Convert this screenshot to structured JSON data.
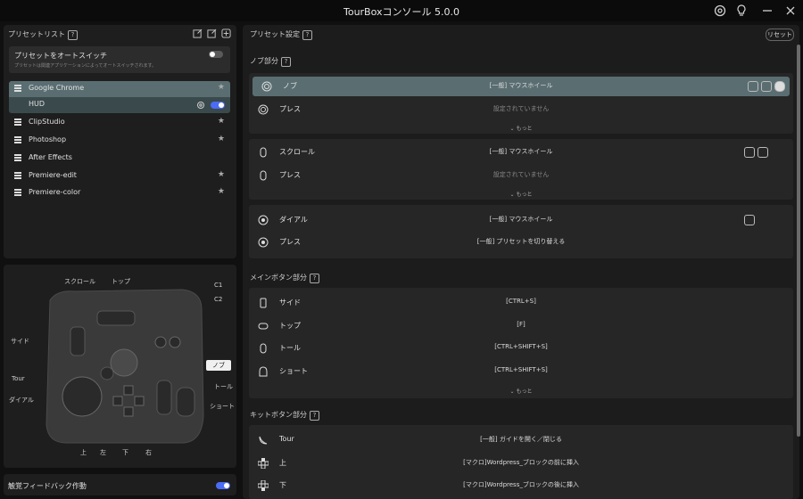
{
  "window": {
    "title": "TourBoxコンソール 5.0.0"
  },
  "preset_list": {
    "title": "プリセットリスト",
    "auto_switch": {
      "label": "プリセットをオートスイッチ",
      "description": "プリセットは関連アプリケーションによってオートスイッチされます。"
    },
    "items": [
      {
        "label": "Google Chrome"
      },
      {
        "label": "HUD"
      },
      {
        "label": "ClipStudio"
      },
      {
        "label": "Photoshop"
      },
      {
        "label": "After Effects"
      },
      {
        "label": "Premiere-edit"
      },
      {
        "label": "Premiere-color"
      }
    ]
  },
  "device": {
    "labels": {
      "scroll": "スクロール",
      "top": "トップ",
      "c1": "C1",
      "c2": "C2",
      "side": "サイド",
      "knob": "ノブ",
      "tour": "Tour",
      "tall": "トール",
      "dial": "ダイアル",
      "short": "ショート",
      "up": "上",
      "left": "左",
      "down": "下",
      "right": "右"
    }
  },
  "haptic": {
    "label": "触覚フィードバック作動",
    "enabled": true
  },
  "settings": {
    "title": "プリセット設定",
    "reset_label": "リセット",
    "knob_section": {
      "title": "ノブ部分",
      "blocks": [
        {
          "rows": [
            {
              "name": "ノブ",
              "value": "[一般] マウスホイール"
            },
            {
              "name": "プレス",
              "value": "設定されていません"
            }
          ],
          "more": "もっと"
        },
        {
          "rows": [
            {
              "name": "スクロール",
              "value": "[一般] マウスホイール"
            },
            {
              "name": "プレス",
              "value": "設定されていません"
            }
          ],
          "more": "もっと"
        },
        {
          "rows": [
            {
              "name": "ダイアル",
              "value": "[一般] マウスホイール"
            },
            {
              "name": "プレス",
              "value": "[一般] プリセットを切り替える"
            }
          ]
        }
      ]
    },
    "main_section": {
      "title": "メインボタン部分",
      "rows": [
        {
          "name": "サイド",
          "value": "[CTRL+S]"
        },
        {
          "name": "トップ",
          "value": "[F]"
        },
        {
          "name": "トール",
          "value": "[CTRL+SHIFT+S]"
        },
        {
          "name": "ショート",
          "value": "[CTRL+SHIFT+S]"
        }
      ],
      "more": "もっと"
    },
    "kit_section": {
      "title": "キットボタン部分",
      "rows": [
        {
          "name": "Tour",
          "value": "[一般] ガイドを開く／閉じる"
        },
        {
          "name": "上",
          "value": "[マクロ]Wordpress_ブロックの前に挿入"
        },
        {
          "name": "下",
          "value": "[マクロ]Wordpress_ブロックの後に挿入"
        }
      ]
    }
  },
  "colors": {
    "accent": "#4a6cf7",
    "selected_row": "#5a6e72",
    "selected_sub": "#3a4a4c"
  }
}
